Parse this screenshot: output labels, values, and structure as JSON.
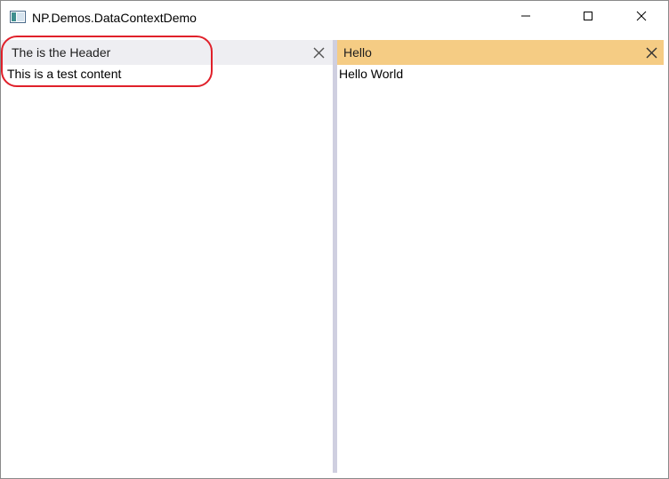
{
  "window": {
    "title": "NP.Demos.DataContextDemo",
    "icon": "window-app-icon",
    "controls": [
      "minimize-icon",
      "maximize-icon",
      "close-icon"
    ]
  },
  "panes": [
    {
      "header": "The is the Header",
      "content": "This is a test content",
      "header_color": "#eeeef2"
    },
    {
      "header": "Hello",
      "content": "Hello World",
      "header_color": "#f5cc84"
    }
  ],
  "annotation": {
    "color": "#e0202a"
  }
}
